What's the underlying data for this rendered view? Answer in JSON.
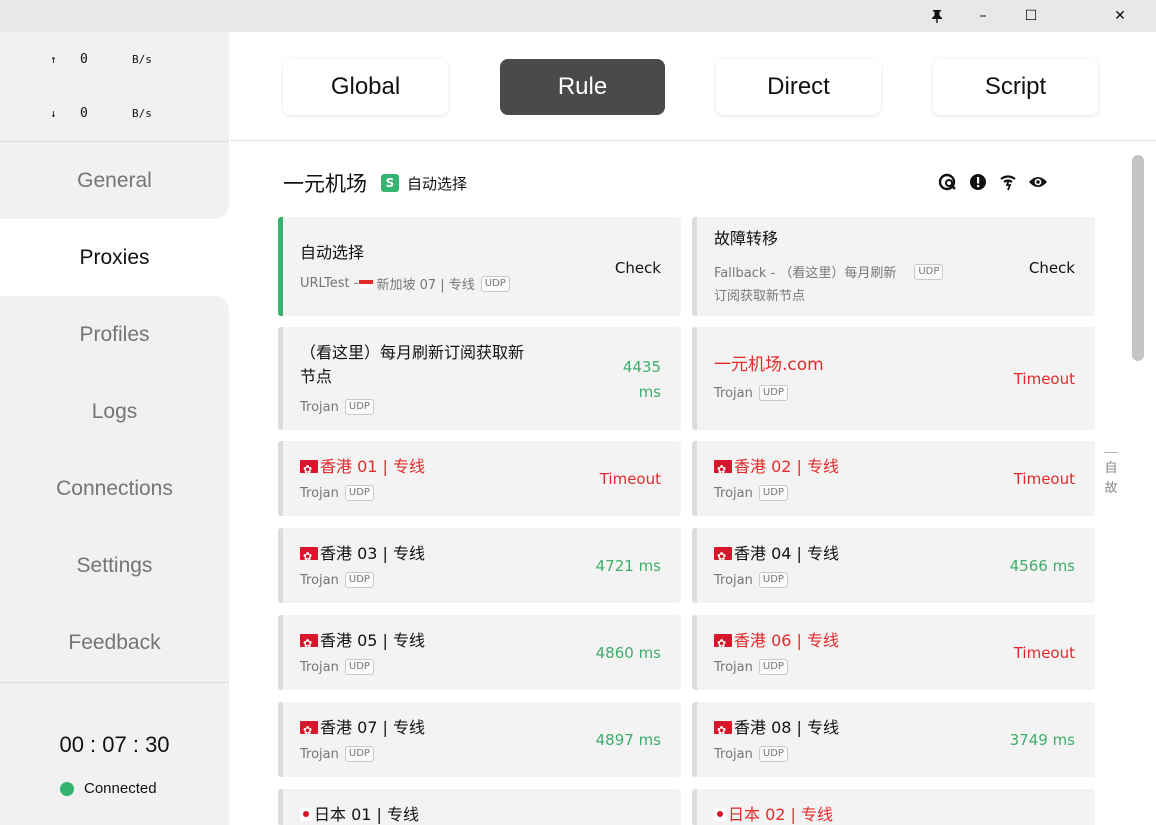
{
  "titlebar": {
    "pin": "🖈",
    "minimize": "–",
    "maximize": "☐",
    "close": "✕"
  },
  "traffic": {
    "up_arrow": "↑",
    "up_value": "0",
    "up_unit": "B/s",
    "down_arrow": "↓",
    "down_value": "0",
    "down_unit": "B/s"
  },
  "nav": [
    "General",
    "Proxies",
    "Profiles",
    "Logs",
    "Connections",
    "Settings",
    "Feedback"
  ],
  "footer": {
    "timer": "00 : 07 : 30",
    "status": "Connected"
  },
  "modes": [
    "Global",
    "Rule",
    "Direct",
    "Script"
  ],
  "group": {
    "title": "一元机场",
    "badge": "S",
    "now": "自动选择"
  },
  "cards": [
    {
      "name": "自动选择",
      "sub": "URLTest - ",
      "sub_flag": "sg",
      "sub_tail": "新加坡 07 | 专线",
      "right": "Check"
    },
    {
      "name": "故障转移",
      "sub1": "Fallback - （看这里）每月刷新",
      "sub2": "订阅获取新节点",
      "right": "Check"
    },
    {
      "name1": "（看这里）每月刷新订阅获取新",
      "name2": "节点",
      "sub": "Trojan",
      "right1": "4435",
      "right2": "ms"
    },
    {
      "name": "一元机场.com",
      "sub": "Trojan",
      "right": "Timeout"
    },
    {
      "name": "香港 01 | 专线",
      "sub": "Trojan",
      "right": "Timeout"
    },
    {
      "name": "香港 02 | 专线",
      "sub": "Trojan",
      "right": "Timeout"
    },
    {
      "name": "香港 03 | 专线",
      "sub": "Trojan",
      "right": "4721 ms"
    },
    {
      "name": "香港 04 | 专线",
      "sub": "Trojan",
      "right": "4566 ms"
    },
    {
      "name": "香港 05 | 专线",
      "sub": "Trojan",
      "right": "4860 ms"
    },
    {
      "name": "香港 06 | 专线",
      "sub": "Trojan",
      "right": "Timeout"
    },
    {
      "name": "香港 07 | 专线",
      "sub": "Trojan",
      "right": "4897 ms"
    },
    {
      "name": "香港 08 | 专线",
      "sub": "Trojan",
      "right": "3749 ms"
    },
    {
      "name": "日本 01 | 专线"
    },
    {
      "name": "日本 02 | 专线"
    }
  ],
  "udp_label": "UDP",
  "side_letters": [
    "自",
    "故"
  ],
  "colors": {
    "accent_green": "#35b46f",
    "error_red": "#e22a2a",
    "active_mode": "#4a4a4a"
  }
}
